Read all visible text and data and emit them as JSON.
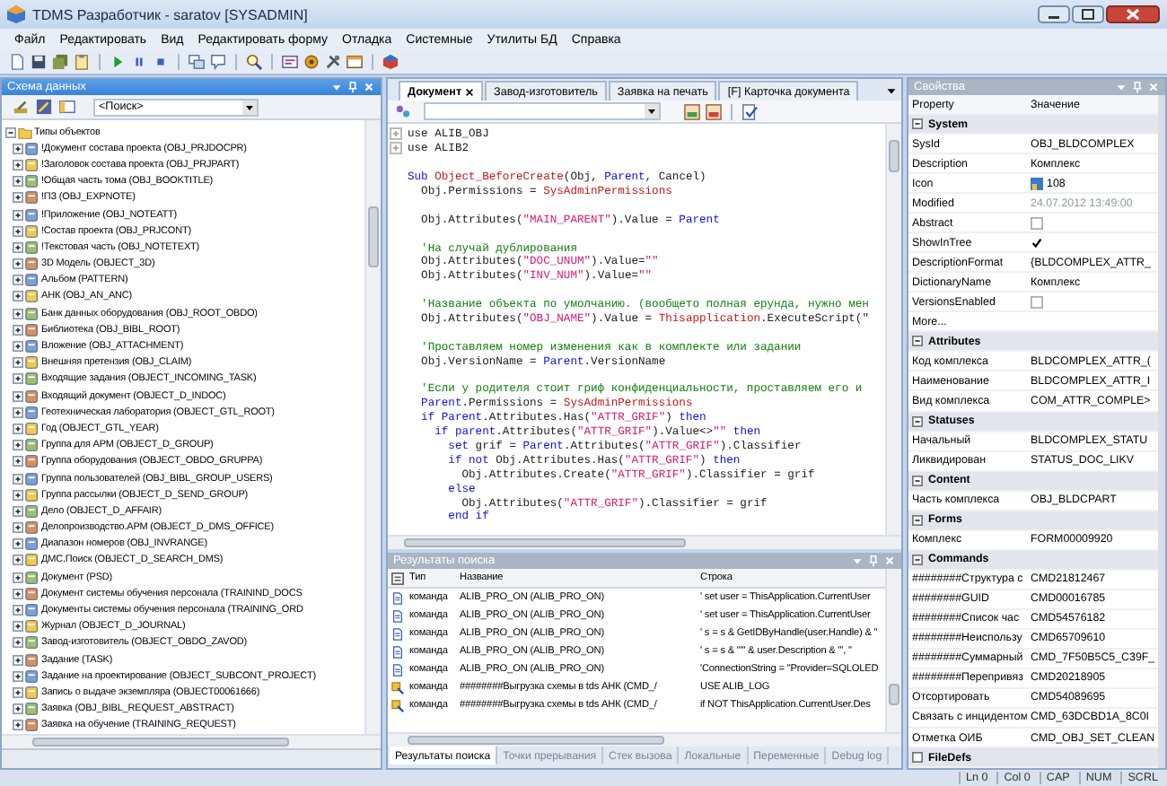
{
  "window": {
    "title": "TDMS Разработчик - saratov [SYSADMIN]"
  },
  "menu": [
    "Файл",
    "Редактировать",
    "Вид",
    "Редактировать форму",
    "Отладка",
    "Системные",
    "Утилиты БД",
    "Справка"
  ],
  "schema_panel": {
    "title": "Схема данных",
    "search": {
      "value": "<Поиск>"
    },
    "tree": {
      "label": "Типы объектов",
      "expanded": true,
      "children": [
        {
          "label": "!Документ состава проекта (OBJ_PRJDOCPR)",
          "expanded": false
        },
        {
          "label": "!Заголовок состава проекта (OBJ_PRJPART)",
          "expanded": false
        },
        {
          "label": "!Общая часть тома (OBJ_BOOKTITLE)",
          "expanded": false
        },
        {
          "label": "!ПЗ (OBJ_EXPNOTE)",
          "expanded": false
        },
        {
          "label": "!Приложение (OBJ_NOTEATT)",
          "expanded": false
        },
        {
          "label": "!Состав проекта (OBJ_PRJCONT)",
          "expanded": false
        },
        {
          "label": "!Текстовая часть (OBJ_NOTETEXT)",
          "expanded": false
        },
        {
          "label": "3D Модель (OBJECT_3D)",
          "expanded": false
        },
        {
          "label": "Альбом (PATTERN)",
          "expanded": false
        },
        {
          "label": "АНК (OBJ_AN_ANC)",
          "expanded": false
        },
        {
          "label": "Банк данных оборудования (OBJ_ROOT_OBDO)",
          "expanded": false
        },
        {
          "label": "Библиотека (OBJ_BIBL_ROOT)",
          "expanded": false
        },
        {
          "label": "Вложение (OBJ_ATTACHMENT)",
          "expanded": false
        },
        {
          "label": "Внешняя претензия (OBJ_CLAIM)",
          "expanded": false
        },
        {
          "label": "Входящие задания (OBJECT_INCOMING_TASK)",
          "expanded": false
        },
        {
          "label": "Входящий документ (OBJECT_D_INDOC)",
          "expanded": false
        },
        {
          "label": "Геотехническая лаборатория (OBJECT_GTL_ROOT)",
          "expanded": false
        },
        {
          "label": "Год (OBJECT_GTL_YEAR)",
          "expanded": false
        },
        {
          "label": "Группа для АРМ (OBJECT_D_GROUP)",
          "expanded": false
        },
        {
          "label": "Группа оборудования (OBJECT_OBDO_GRUPPA)",
          "expanded": false
        },
        {
          "label": "Группа пользователей (OBJ_BIBL_GROUP_USERS)",
          "expanded": false
        },
        {
          "label": "Группа рассылки (OBJECT_D_SEND_GROUP)",
          "expanded": false
        },
        {
          "label": "Дело (OBJECT_D_AFFAIR)",
          "expanded": false
        },
        {
          "label": "Делопроизводство.АРМ (OBJECT_D_DMS_OFFICE)",
          "expanded": false
        },
        {
          "label": "Диапазон номеров (OBJ_INVRANGE)",
          "expanded": false
        },
        {
          "label": "ДМС.Поиск (OBJECT_D_SEARCH_DMS)",
          "expanded": false
        },
        {
          "label": "Документ (PSD)",
          "expanded": false
        },
        {
          "label": "Документ системы обучения персонала (TRAININD_DOCS",
          "expanded": false
        },
        {
          "label": "Документы системы обучения персонала (TRAINING_ORD",
          "expanded": false
        },
        {
          "label": "Журнал (OBJECT_D_JOURNAL)",
          "expanded": false
        },
        {
          "label": "Завод-изготовитель (OBJECT_OBDO_ZAVOD)",
          "expanded": false
        },
        {
          "label": "Задание (TASK)",
          "expanded": false
        },
        {
          "label": "Задание на проектирование (OBJECT_SUBCONT_PROJECT)",
          "expanded": false
        },
        {
          "label": "Запись о выдаче экземпляра (OBJECT00061666)",
          "expanded": false
        },
        {
          "label": "Заявка (OBJ_BIBL_REQUEST_ABSTRACT)",
          "expanded": false
        },
        {
          "label": "Заявка на обучение (TRAINING_REQUEST)",
          "expanded": false
        }
      ]
    }
  },
  "editor": {
    "tabs": [
      {
        "label": "Документ",
        "selected": true
      },
      {
        "label": "Завод-изготовитель",
        "selected": false
      },
      {
        "label": "Заявка на печать",
        "selected": false
      },
      {
        "label": "[F] Карточка документа",
        "selected": false
      }
    ],
    "lines": [
      {
        "fold": true,
        "segments": [
          {
            "kind": "txt",
            "t": "use ALIB_OBJ"
          }
        ]
      },
      {
        "fold": true,
        "segments": [
          {
            "kind": "txt",
            "t": "use ALIB2"
          }
        ]
      },
      {
        "space_before": true,
        "segments": [
          {
            "kind": "kw",
            "t": "Sub "
          },
          {
            "kind": "id",
            "t": "Object_BeforeCreate"
          },
          {
            "kind": "txt",
            "t": "(Obj, "
          },
          {
            "kind": "kw",
            "t": "Parent"
          },
          {
            "kind": "txt",
            "t": ", Cancel)"
          }
        ]
      },
      {
        "segments": [
          {
            "kind": "txt",
            "t": "  Obj.Permissions = "
          },
          {
            "kind": "id",
            "t": "SysAdminPermissions"
          }
        ]
      },
      {
        "space_before": true,
        "segments": [
          {
            "kind": "txt",
            "t": "  Obj.Attributes("
          },
          {
            "kind": "str",
            "t": "\"MAIN_PARENT\""
          },
          {
            "kind": "txt",
            "t": ").Value = "
          },
          {
            "kind": "kw",
            "t": "Parent"
          }
        ]
      },
      {
        "space_before": true,
        "segments": [
          {
            "kind": "cmt",
            "t": "  'На случай дублирования"
          }
        ]
      },
      {
        "segments": [
          {
            "kind": "txt",
            "t": "  Obj.Attributes("
          },
          {
            "kind": "str",
            "t": "\"DOC_UNUM\""
          },
          {
            "kind": "txt",
            "t": ").Value="
          },
          {
            "kind": "str",
            "t": "\"\""
          }
        ]
      },
      {
        "segments": [
          {
            "kind": "txt",
            "t": "  Obj.Attributes("
          },
          {
            "kind": "str",
            "t": "\"INV_NUM\""
          },
          {
            "kind": "txt",
            "t": ").Value="
          },
          {
            "kind": "str",
            "t": "\"\""
          }
        ]
      },
      {
        "space_before": true,
        "segments": [
          {
            "kind": "cmt",
            "t": "  'Название объекта по умолчанию. (вообщето полная ерунда, нужно мен"
          }
        ]
      },
      {
        "segments": [
          {
            "kind": "txt",
            "t": "  Obj.Attributes("
          },
          {
            "kind": "str",
            "t": "\"OBJ_NAME\""
          },
          {
            "kind": "txt",
            "t": ").Value = "
          },
          {
            "kind": "id",
            "t": "Thisapplication"
          },
          {
            "kind": "txt",
            "t": ".ExecuteScript(\""
          }
        ]
      },
      {
        "space_before": true,
        "segments": [
          {
            "kind": "cmt",
            "t": "  'Проставляем номер изменения как в комплекте или задании"
          }
        ]
      },
      {
        "segments": [
          {
            "kind": "txt",
            "t": "  Obj.VersionName = "
          },
          {
            "kind": "kw",
            "t": "Parent"
          },
          {
            "kind": "txt",
            "t": ".VersionName"
          }
        ]
      },
      {
        "space_before": true,
        "segments": [
          {
            "kind": "cmt",
            "t": "  'Если у родителя стоит гриф конфиденциальности, проставляем его и"
          }
        ]
      },
      {
        "segments": [
          {
            "kind": "kw",
            "t": "  Parent"
          },
          {
            "kind": "txt",
            "t": ".Permissions = "
          },
          {
            "kind": "id",
            "t": "SysAdminPermissions"
          }
        ]
      },
      {
        "segments": [
          {
            "kind": "kw",
            "t": "  if Parent"
          },
          {
            "kind": "txt",
            "t": ".Attributes.Has("
          },
          {
            "kind": "str",
            "t": "\"ATTR_GRIF\""
          },
          {
            "kind": "txt",
            "t": ") "
          },
          {
            "kind": "kw",
            "t": "then"
          }
        ]
      },
      {
        "segments": [
          {
            "kind": "kw",
            "t": "    if parent"
          },
          {
            "kind": "txt",
            "t": ".Attributes("
          },
          {
            "kind": "str",
            "t": "\"ATTR_GRIF\""
          },
          {
            "kind": "txt",
            "t": ").Value<>"
          },
          {
            "kind": "str",
            "t": "\"\""
          },
          {
            "kind": "kw",
            "t": " then"
          }
        ]
      },
      {
        "segments": [
          {
            "kind": "kw",
            "t": "      set "
          },
          {
            "kind": "txt",
            "t": "grif = "
          },
          {
            "kind": "kw",
            "t": "Parent"
          },
          {
            "kind": "txt",
            "t": ".Attributes("
          },
          {
            "kind": "str",
            "t": "\"ATTR_GRIF\""
          },
          {
            "kind": "txt",
            "t": ").Classifier"
          }
        ]
      },
      {
        "segments": [
          {
            "kind": "kw",
            "t": "      if not "
          },
          {
            "kind": "txt",
            "t": "Obj.Attributes.Has("
          },
          {
            "kind": "str",
            "t": "\"ATTR_GRIF\""
          },
          {
            "kind": "txt",
            "t": ") "
          },
          {
            "kind": "kw",
            "t": "then"
          }
        ]
      },
      {
        "segments": [
          {
            "kind": "txt",
            "t": "        Obj.Attributes.Create("
          },
          {
            "kind": "str",
            "t": "\"ATTR_GRIF\""
          },
          {
            "kind": "txt",
            "t": ").Classifier = grif"
          }
        ]
      },
      {
        "segments": [
          {
            "kind": "kw",
            "t": "      else"
          }
        ]
      },
      {
        "segments": [
          {
            "kind": "txt",
            "t": "        Obj.Attributes("
          },
          {
            "kind": "str",
            "t": "\"ATTR_GRIF\""
          },
          {
            "kind": "txt",
            "t": ").Classifier = grif"
          }
        ]
      },
      {
        "segments": [
          {
            "kind": "kw",
            "t": "      end if"
          }
        ]
      }
    ]
  },
  "results": {
    "title": "Результаты поиска",
    "columns": [
      "Тип",
      "Название",
      "Строка"
    ],
    "rows": [
      {
        "kind": "script",
        "type": "команда",
        "name": "ALIB_PRO_ON (ALIB_PRO_ON)",
        "line": "' set user = ThisApplication.CurrentUser"
      },
      {
        "kind": "script",
        "type": "команда",
        "name": "ALIB_PRO_ON (ALIB_PRO_ON)",
        "line": "' set user = ThisApplication.CurrentUser"
      },
      {
        "kind": "script",
        "type": "команда",
        "name": "ALIB_PRO_ON (ALIB_PRO_ON)",
        "line": "' s = s & GetIDByHandle(user.Handle) & \""
      },
      {
        "kind": "script",
        "type": "команда",
        "name": "ALIB_PRO_ON (ALIB_PRO_ON)",
        "line": "' s = s & \"'\" & user.Description & \"', \""
      },
      {
        "kind": "script",
        "type": "команда",
        "name": "ALIB_PRO_ON (ALIB_PRO_ON)",
        "line": "'ConnectionString = \"Provider=SQLOLED"
      },
      {
        "kind": "command",
        "type": "команда",
        "name": "########Выгрузка схемы в tds АНК (CMD_/",
        "line": "USE ALIB_LOG"
      },
      {
        "kind": "command",
        "type": "команда",
        "name": "########Выгрузка схемы в tds АНК (CMD_/",
        "line": "if NOT ThisApplication.CurrentUser.Des"
      }
    ],
    "tabs": [
      {
        "label": "Результаты поиска",
        "selected": true
      },
      {
        "label": "Точки прерывания",
        "selected": false
      },
      {
        "label": "Стек вызова",
        "selected": false
      },
      {
        "label": "Локальные",
        "selected": false
      },
      {
        "label": "Переменные",
        "selected": false
      },
      {
        "label": "Debug log",
        "selected": false
      }
    ]
  },
  "properties": {
    "title": "Свойства",
    "columns": [
      "Property",
      "Значение"
    ],
    "sections": [
      {
        "title": "System",
        "expanded": true,
        "rows": [
          {
            "kind": "text",
            "name": "SysId",
            "value": "OBJ_BLDCOMPLEX"
          },
          {
            "kind": "text",
            "name": "Description",
            "value": "Комплекс"
          },
          {
            "kind": "icon",
            "name": "Icon",
            "value": "108"
          },
          {
            "kind": "muted",
            "name": "Modified",
            "value": "24.07.2012 13:49:00"
          },
          {
            "kind": "check",
            "name": "Abstract",
            "checked": false
          },
          {
            "kind": "check",
            "name": "ShowInTree",
            "checked": true
          },
          {
            "kind": "text",
            "name": "DescriptionFormat",
            "value": "{BLDCOMPLEX_ATTR_"
          },
          {
            "kind": "text",
            "name": "DictionaryName",
            "value": "Комплекс"
          },
          {
            "kind": "check",
            "name": "VersionsEnabled",
            "checked": false
          },
          {
            "kind": "text",
            "name": "More..."
          }
        ]
      },
      {
        "title": "Attributes",
        "expanded": true,
        "rows": [
          {
            "kind": "text",
            "name": "Код комплекса",
            "value": "BLDCOMPLEX_ATTR_("
          },
          {
            "kind": "text",
            "name": "Наименование",
            "value": "BLDCOMPLEX_ATTR_I"
          },
          {
            "kind": "text",
            "name": "Вид комплекса",
            "value": "COM_ATTR_COMPLE>"
          }
        ]
      },
      {
        "title": "Statuses",
        "expanded": true,
        "rows": [
          {
            "kind": "text",
            "name": "Начальный",
            "value": "BLDCOMPLEX_STATU"
          },
          {
            "kind": "text",
            "name": "Ликвидирован",
            "value": "STATUS_DOC_LIKV"
          }
        ]
      },
      {
        "title": "Content",
        "expanded": true,
        "rows": [
          {
            "kind": "text",
            "name": "Часть комплекса",
            "value": "OBJ_BLDCPART"
          }
        ]
      },
      {
        "title": "Forms",
        "expanded": true,
        "rows": [
          {
            "kind": "text",
            "name": "Комплекс",
            "value": "FORM00009920"
          }
        ]
      },
      {
        "title": "Commands",
        "expanded": true,
        "rows": [
          {
            "kind": "text",
            "name": "########Структура с",
            "value": "CMD21812467"
          },
          {
            "kind": "text",
            "name": "########GUID",
            "value": "CMD00016785"
          },
          {
            "kind": "text",
            "name": "########Список час",
            "value": "CMD54576182"
          },
          {
            "kind": "text",
            "name": "########Неиспользу",
            "value": "CMD65709610"
          },
          {
            "kind": "text",
            "name": "########Суммарный",
            "value": "CMD_7F50B5C5_C39F_"
          },
          {
            "kind": "text",
            "name": "########Перепривяз",
            "value": "CMD20218905"
          },
          {
            "kind": "text",
            "name": "Отсортировать",
            "value": "CMD54089695"
          },
          {
            "kind": "text",
            "name": "Связать с инцидентом",
            "value": "CMD_63DCBD1A_8C0I"
          },
          {
            "kind": "text",
            "name": "Отметка ОИБ",
            "value": "CMD_OBJ_SET_CLEAN"
          }
        ]
      },
      {
        "title": "FileDefs",
        "expanded": false
      }
    ]
  },
  "status_bar": [
    "Ln 0",
    "Col 0",
    "CAP",
    "NUM",
    "SCRL"
  ]
}
